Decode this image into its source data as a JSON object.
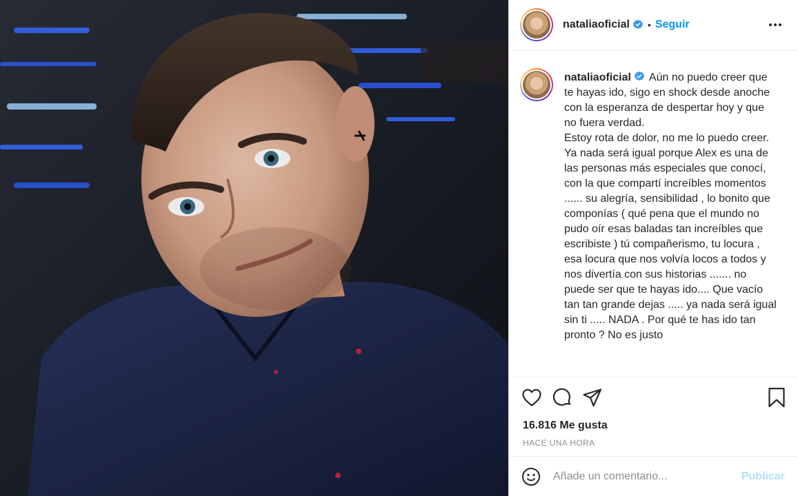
{
  "post": {
    "username": "nataliaoficial",
    "follow_label": "Seguir",
    "separator": "•",
    "caption": "Aún no puedo creer que te hayas ido, sigo en shock desde anoche con la esperanza de despertar hoy y que no fuera verdad.\nEstoy rota de dolor, no me lo puedo creer. Ya nada será igual porque Alex es una de las personas más especiales que conocí, con la que compartí increíbles momentos ...... su alegría, sensibilidad , lo bonito que componías ( qué pena que el mundo no pudo oír esas baladas tan increíbles que escribiste ) tú compañerismo, tu locura , esa locura que nos volvía locos a todos y nos divertía con sus historias ....... no puede ser que te hayas ido.... Que vacío tan tan grande dejas ..... ya nada será igual sin ti ..... NADA . Por qué te has ido tan pronto ? No es justo",
    "likes": "16.816 Me gusta",
    "time_ago": "HACE UNA HORA"
  },
  "comment": {
    "placeholder": "Añade un comentario...",
    "publish_label": "Publicar"
  },
  "icons": {
    "verified": "verified-badge-icon",
    "more": "more-options-icon",
    "like": "heart-icon",
    "comment": "comment-icon",
    "share": "share-icon",
    "save": "bookmark-icon",
    "emoji": "emoji-icon"
  },
  "colors": {
    "accent": "#0095f6",
    "publish_disabled": "#b2dffc",
    "muted": "#8e8e8e",
    "text": "#262626"
  }
}
